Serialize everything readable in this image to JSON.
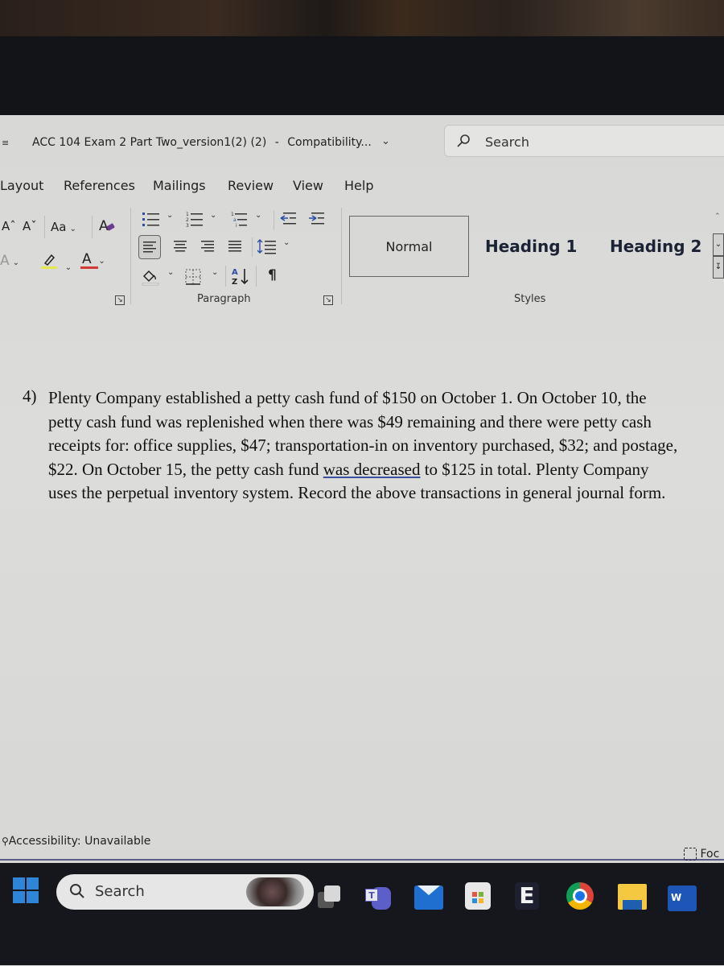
{
  "window": {
    "title": "ACC 104 Exam 2 Part Two_version1(2) (2)",
    "separator": "-",
    "mode": "Compatibility...",
    "search_placeholder": "Search"
  },
  "menu": {
    "tabs": [
      "Layout",
      "References",
      "Mailings",
      "Review",
      "View",
      "Help"
    ]
  },
  "ribbon": {
    "font_group": {
      "grow_font": "Aˆ",
      "shrink_font": "Aˇ",
      "change_case": "Aa",
      "clear_formatting": "Aₒ",
      "text_effects": "A",
      "highlight_color": "#e4e84a",
      "font_color_letter": "A",
      "font_color": "#d23b35"
    },
    "paragraph_group": {
      "label": "Paragraph",
      "sort": "A↓Z",
      "show_marks": "¶"
    },
    "styles_group": {
      "label": "Styles",
      "styles": [
        "Normal",
        "Heading 1",
        "Heading 2"
      ],
      "selected": "Normal"
    }
  },
  "document": {
    "question_number": "4)",
    "lines": [
      "Plenty Company established a petty cash fund of $150 on October 1. On October 10, the",
      "petty cash fund was replenished when there was $49 remaining and there were petty cash",
      "receipts for: office supplies, $47; transportation-in on inventory purchased, $32; and postage,"
    ],
    "line4_before": "$22. On October 15, the petty cash fund ",
    "line4_underlined": "was decreased",
    "line4_after": " to $125 in total. Plenty Company",
    "line5": "uses the perpetual inventory system. Record the above transactions in general journal form."
  },
  "status": {
    "accessibility": "Accessibility: Unavailable",
    "focus": "Foc"
  },
  "taskbar": {
    "search_label": "Search",
    "apps": [
      "Task View",
      "Teams",
      "Mail",
      "Microsoft Store",
      "E",
      "Chrome",
      "File Explorer",
      "Word"
    ],
    "e_label": "E",
    "word_label": "W",
    "teams_label": "T"
  }
}
